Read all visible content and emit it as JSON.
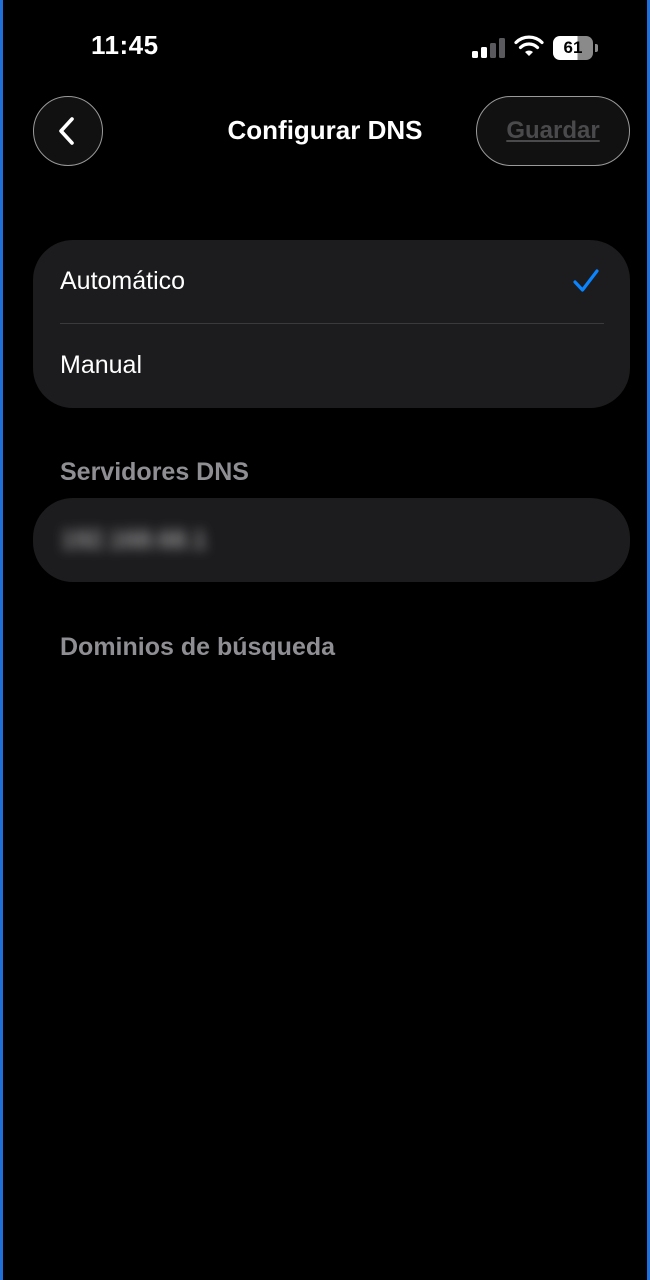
{
  "status_bar": {
    "time": "11:45",
    "battery_level": "61",
    "signal_icon": "cellular-signal-icon",
    "wifi_icon": "wifi-icon",
    "battery_icon": "battery-icon"
  },
  "nav": {
    "back_icon": "chevron-left-icon",
    "title": "Configurar DNS",
    "save_label": "Guardar",
    "save_enabled": false
  },
  "dns_mode": {
    "options": [
      {
        "label": "Automático",
        "selected": true
      },
      {
        "label": "Manual",
        "selected": false
      }
    ],
    "check_icon": "checkmark-icon"
  },
  "dns_servers": {
    "header": "Servidores DNS",
    "value": "192.168.68.1",
    "value_obscured": true
  },
  "search_domains": {
    "header": "Dominios de búsqueda"
  },
  "colors": {
    "background": "#000000",
    "group_background": "#1c1c1e",
    "accent": "#0a84ff",
    "secondary_text": "#8e8e93",
    "disabled_text": "#4a4a4c"
  }
}
